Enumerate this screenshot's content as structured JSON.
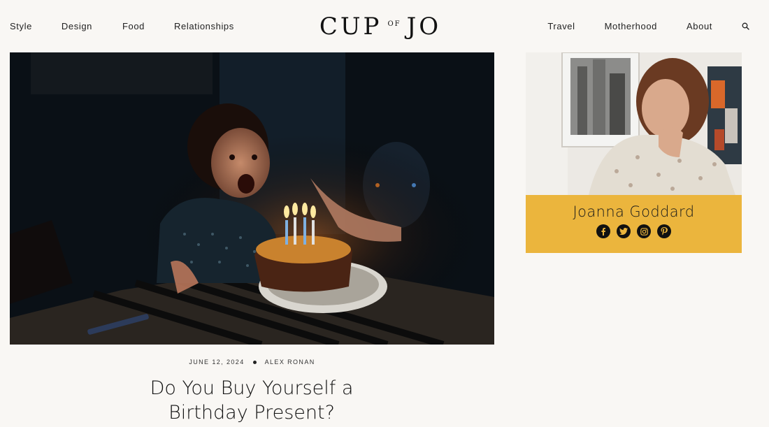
{
  "nav": {
    "left": [
      "Style",
      "Design",
      "Food",
      "Relationships"
    ],
    "right": [
      "Travel",
      "Motherhood",
      "About"
    ]
  },
  "logo": {
    "cup": "CUP",
    "of": "OF",
    "jo": "JO"
  },
  "post": {
    "date": "JUNE 12, 2024",
    "author": "ALEX RONAN",
    "title": "Do You Buy Yourself a Birthday Present?"
  },
  "sidebar": {
    "author_name": "Joanna Goddard",
    "social_icons": [
      "facebook-icon",
      "twitter-icon",
      "instagram-icon",
      "pinterest-icon"
    ]
  },
  "colors": {
    "background": "#f9f7f4",
    "author_box": "#ebb53d",
    "text": "#111111"
  }
}
